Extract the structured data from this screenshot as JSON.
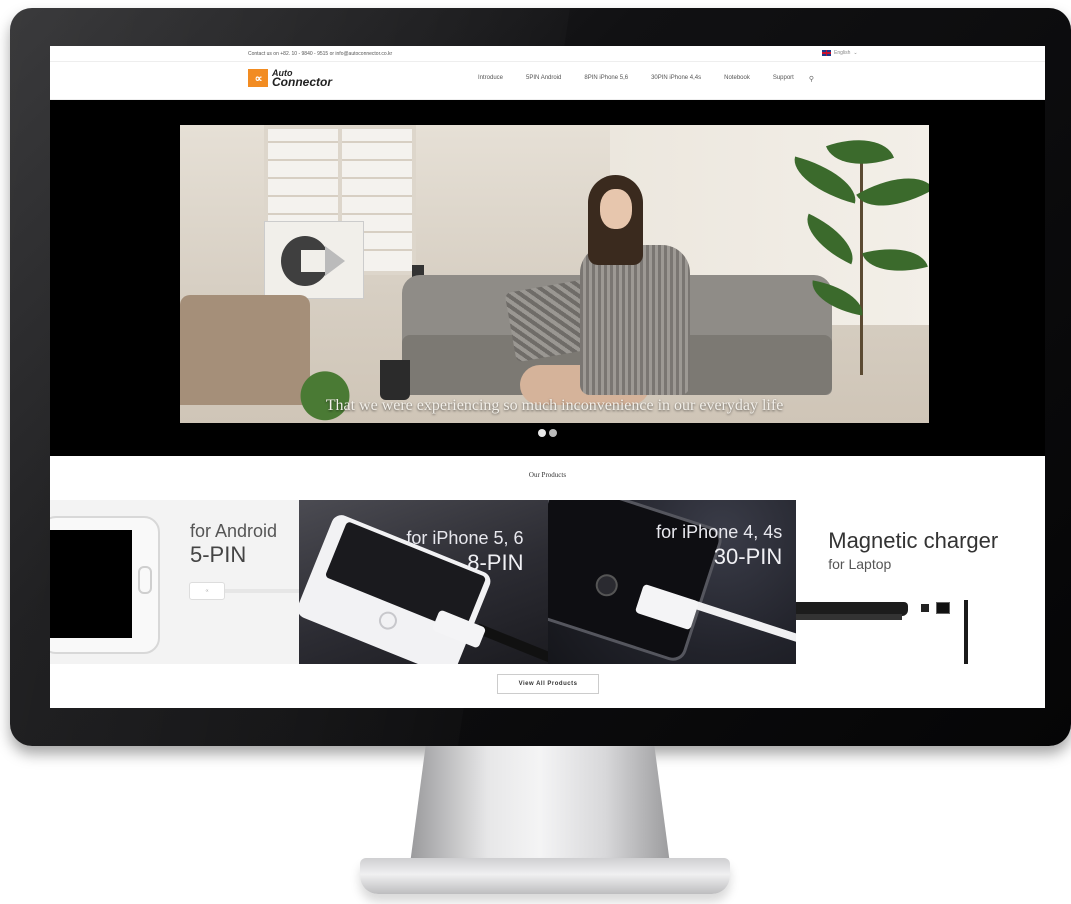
{
  "topbar": {
    "contact": "Contact us on +82. 10 - 9840 - 9515 or info@autoconnector.co.kr",
    "language": "English"
  },
  "header": {
    "logo_mark": "∝",
    "logo_line1": "Auto",
    "logo_line2": "Connector",
    "nav": [
      "Introduce",
      "5PIN Android",
      "8PIN iPhone 5,6",
      "30PIN iPhone 4,4s",
      "Notebook",
      "Support"
    ],
    "search_icon": "search-icon"
  },
  "hero": {
    "caption": "That we were experiencing so much inconvenience in our everyday life",
    "slides_count": 2,
    "active_slide": 1
  },
  "products": {
    "title": "Our Products",
    "tiles": [
      {
        "line1": "for Android",
        "line2": "5-PIN"
      },
      {
        "line1": "for iPhone 5, 6",
        "line2": "8-PIN"
      },
      {
        "line1": "for iPhone 4, 4s",
        "line2": "30-PIN"
      },
      {
        "line1": "Magnetic charger",
        "line2": "for Laptop"
      }
    ],
    "view_all": "View All Products"
  },
  "colors": {
    "brand_orange": "#f28c22",
    "hero_bg": "#000000",
    "monitor_bezel": "#111113"
  }
}
